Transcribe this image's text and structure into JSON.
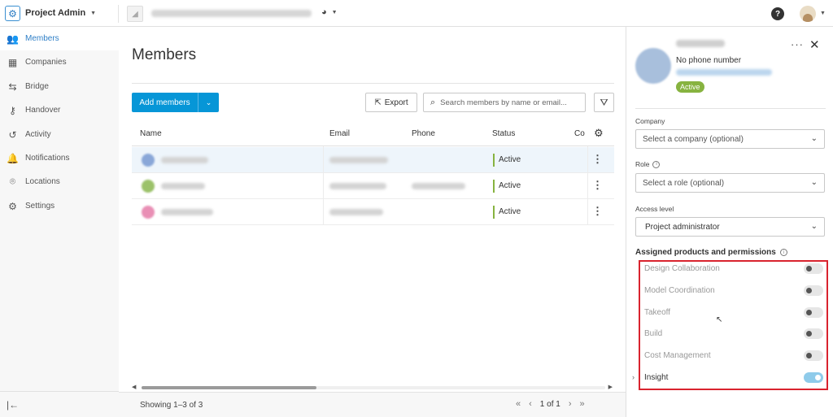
{
  "topbar": {
    "app_title": "Project Admin",
    "help_label": "?"
  },
  "sidebar": {
    "items": [
      {
        "label": "Members",
        "icon": "members-icon",
        "active": true
      },
      {
        "label": "Companies",
        "icon": "companies-icon",
        "active": false
      },
      {
        "label": "Bridge",
        "icon": "bridge-icon",
        "active": false
      },
      {
        "label": "Handover",
        "icon": "handover-icon",
        "active": false
      },
      {
        "label": "Activity",
        "icon": "activity-icon",
        "active": false
      },
      {
        "label": "Notifications",
        "icon": "notifications-icon",
        "active": false
      },
      {
        "label": "Locations",
        "icon": "locations-icon",
        "active": false
      },
      {
        "label": "Settings",
        "icon": "settings-icon",
        "active": false
      }
    ]
  },
  "main": {
    "title": "Members",
    "add_members_label": "Add members",
    "export_label": "Export",
    "search_placeholder": "Search members by name or email...",
    "columns": [
      "Name",
      "Email",
      "Phone",
      "Status",
      "Co"
    ],
    "rows": [
      {
        "status": "Active",
        "avatar_color": "#8aa7d8"
      },
      {
        "status": "Active",
        "avatar_color": "#9cc26a"
      },
      {
        "status": "Active",
        "avatar_color": "#e98fb5"
      }
    ],
    "showing": "Showing 1–3 of 3",
    "page": "1 of 1"
  },
  "panel": {
    "phone": "No phone number",
    "status_badge": "Active",
    "company_label": "Company",
    "company_placeholder": "Select a company (optional)",
    "role_label": "Role",
    "role_placeholder": "Select a role (optional)",
    "access_label": "Access level",
    "access_value": "Project administrator",
    "permissions_title": "Assigned products and permissions",
    "permissions": [
      {
        "label": "Design Collaboration",
        "enabled": false
      },
      {
        "label": "Model Coordination",
        "enabled": false
      },
      {
        "label": "Takeoff",
        "enabled": false
      },
      {
        "label": "Build",
        "enabled": false
      },
      {
        "label": "Cost Management",
        "enabled": false
      },
      {
        "label": "Insight",
        "enabled": true
      }
    ]
  },
  "colors": {
    "accent": "#0696d7",
    "active_status": "#87b340",
    "highlight": "#d9232e"
  }
}
